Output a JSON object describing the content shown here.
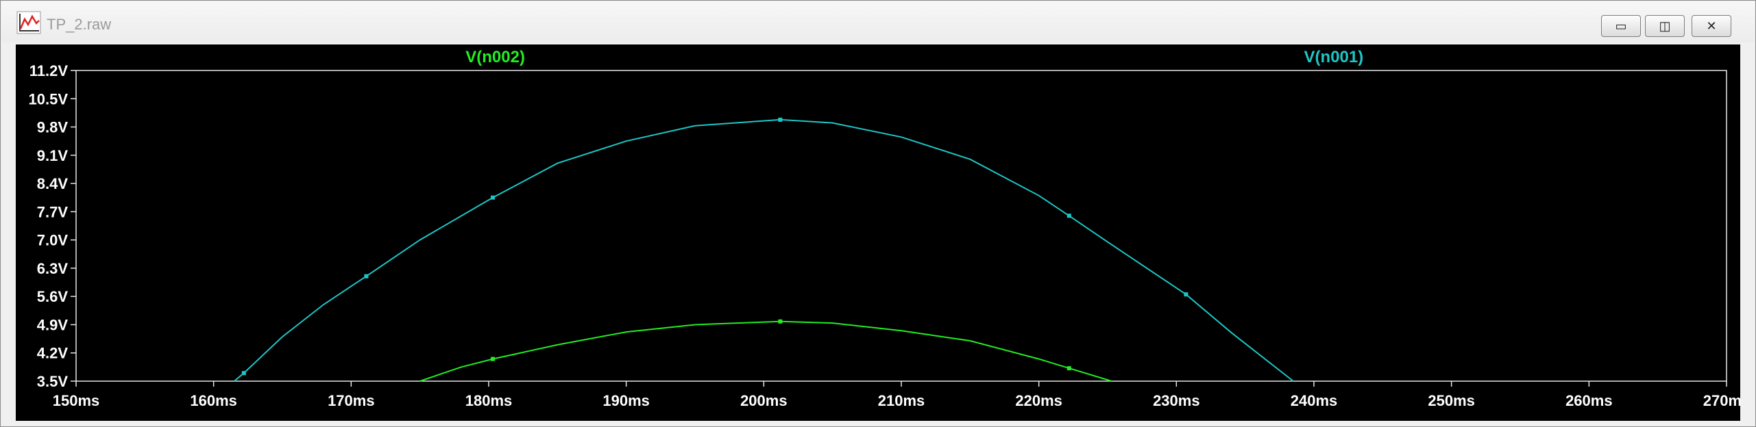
{
  "window": {
    "title": "TP_2.raw",
    "app_icon": "waveform-plot-icon",
    "controls": [
      {
        "name": "minimize-icon",
        "glyph": "▭"
      },
      {
        "name": "restore-icon",
        "glyph": "◫"
      },
      {
        "name": "close-icon",
        "glyph": "✕"
      }
    ]
  },
  "colors": {
    "background": "#000000",
    "axis": "#e6e6e6",
    "text": "#ffffff",
    "V(n001)": "#1fc6c6",
    "V(n002)": "#22ee22"
  },
  "chart_data": {
    "type": "line",
    "title": "",
    "xlabel": "",
    "ylabel": "",
    "xlim": [
      150,
      270
    ],
    "ylim": [
      3.5,
      11.2
    ],
    "grid": false,
    "x_unit": "ms",
    "y_unit": "V",
    "x_ticks": [
      "150ms",
      "160ms",
      "170ms",
      "180ms",
      "190ms",
      "200ms",
      "210ms",
      "220ms",
      "230ms",
      "240ms",
      "250ms",
      "260ms",
      "270ms"
    ],
    "y_ticks": [
      "11.2V",
      "10.5V",
      "9.8V",
      "9.1V",
      "8.4V",
      "7.7V",
      "7.0V",
      "6.3V",
      "5.6V",
      "4.9V",
      "4.2V",
      "3.5V"
    ],
    "series": [
      {
        "name": "V(n002)",
        "x": [
          175,
          178,
          180.3,
          185,
          190,
          195,
          201.2,
          205,
          210,
          215,
          220,
          222.2,
          225.3
        ],
        "y": [
          3.5,
          3.85,
          4.05,
          4.4,
          4.72,
          4.9,
          4.98,
          4.94,
          4.75,
          4.5,
          4.05,
          3.82,
          3.5
        ],
        "markers_x": [
          180.3,
          201.2,
          222.2
        ],
        "markers_y": [
          4.05,
          4.98,
          3.82
        ]
      },
      {
        "name": "V(n001)",
        "x": [
          161.5,
          162.2,
          165,
          168,
          171.1,
          175,
          180.3,
          185,
          190,
          195,
          201.2,
          205,
          210,
          215,
          220,
          222.2,
          225,
          230.7,
          234,
          238.5
        ],
        "y": [
          3.5,
          3.7,
          4.6,
          5.4,
          6.1,
          7.0,
          8.05,
          8.9,
          9.45,
          9.83,
          9.98,
          9.9,
          9.55,
          9.0,
          8.1,
          7.6,
          6.95,
          5.65,
          4.7,
          3.5
        ],
        "markers_x": [
          162.2,
          171.1,
          180.3,
          201.2,
          222.2,
          230.7
        ],
        "markers_y": [
          3.7,
          6.1,
          8.05,
          9.98,
          7.6,
          5.65
        ]
      }
    ]
  }
}
